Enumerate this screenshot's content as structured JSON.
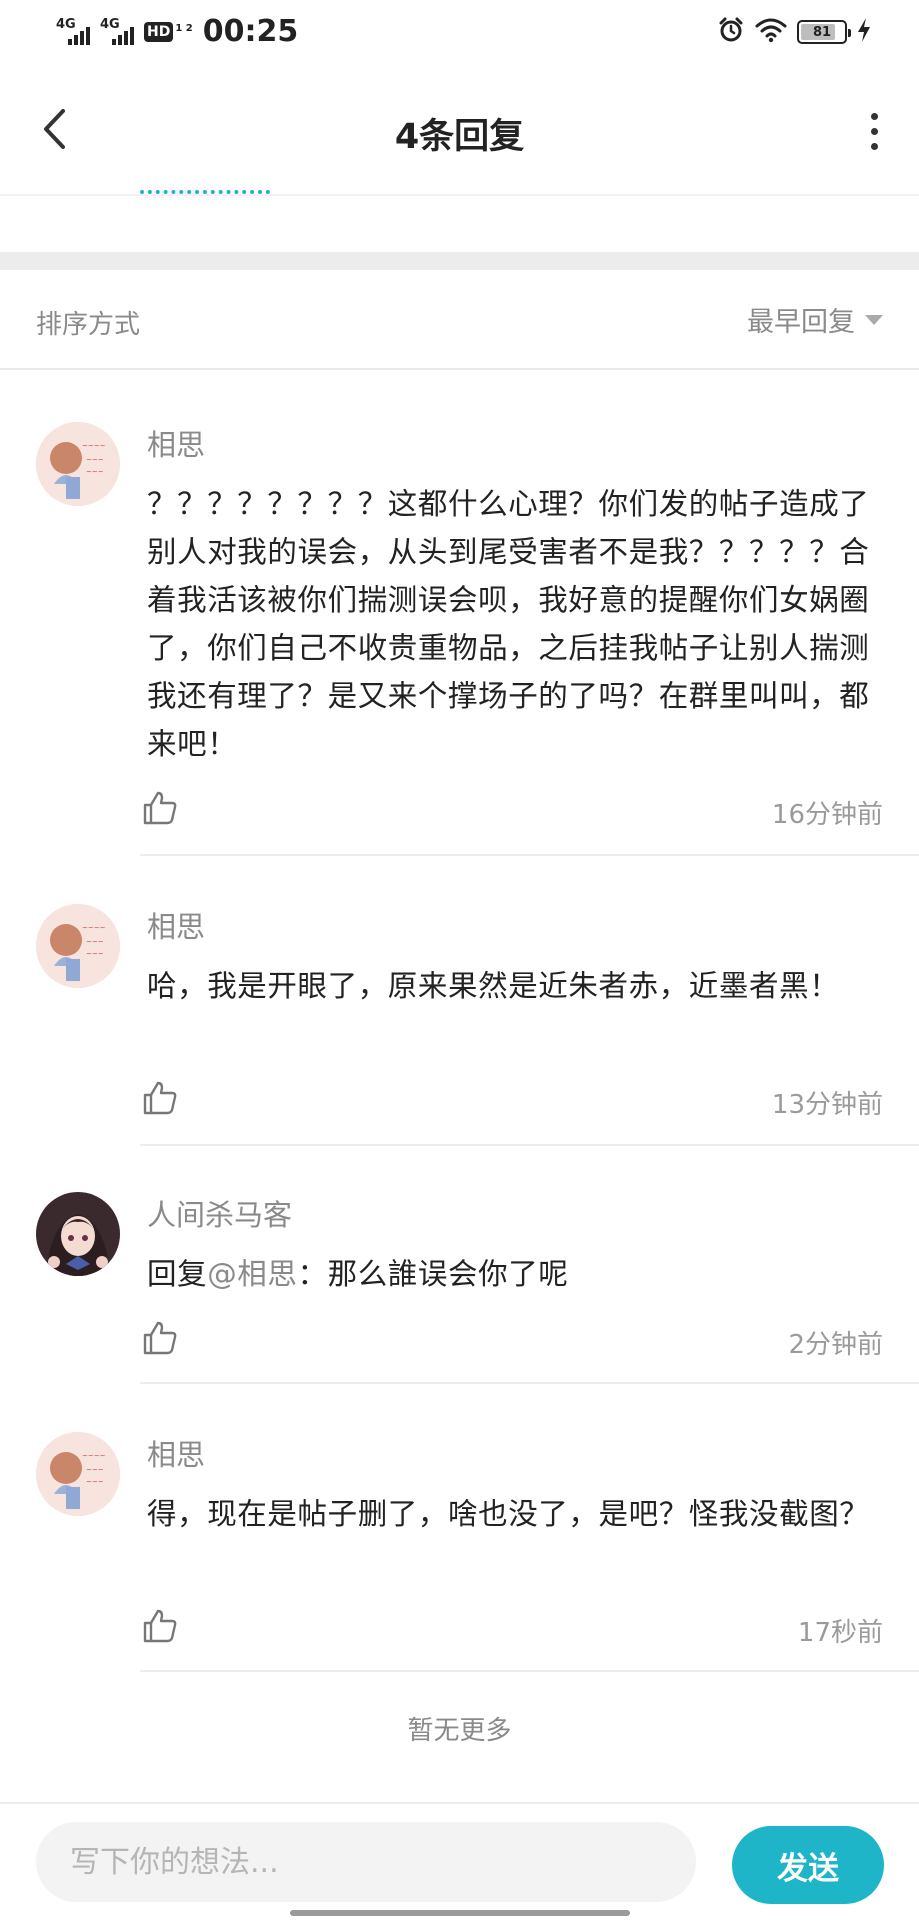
{
  "status_bar": {
    "signal1": "4G",
    "signal2": "4G",
    "hd": "HD",
    "hd_sup": "1 2",
    "time": "00:25",
    "battery": "81",
    "battery_level": 0.81
  },
  "header": {
    "title": "4条回复"
  },
  "sort": {
    "label": "排序方式",
    "value": "最早回复"
  },
  "comments": [
    {
      "user": "相思",
      "text": "？？？？？？？？这都什么心理？你们发的帖子造成了别人对我的误会，从头到尾受害者不是我？？？？？合着我活该被你们揣测误会呗，我好意的提醒你们女娲圈了，你们自己不收贵重物品，之后挂我帖子让别人揣测我还有理了？是又来个撑场子的了吗？在群里叫叫，都来吧！",
      "time": "16分钟前"
    },
    {
      "user": "相思",
      "text": "哈，我是开眼了，原来果然是近朱者赤，近墨者黑！",
      "time": "13分钟前"
    },
    {
      "user": "人间杀马客",
      "reply_prefix": "回复",
      "mention": "@相思",
      "text": "：那么誰误会你了呢",
      "time": "2分钟前"
    },
    {
      "user": "相思",
      "text": "得，现在是帖子删了，啥也没了，是吧？怪我没截图？",
      "time": "17秒前"
    }
  ],
  "no_more": "暂无更多",
  "compose": {
    "placeholder": "写下你的想法...",
    "send_label": "发送"
  },
  "colors": {
    "accent": "#1fb5c9",
    "muted_text": "#8a8a8a"
  }
}
